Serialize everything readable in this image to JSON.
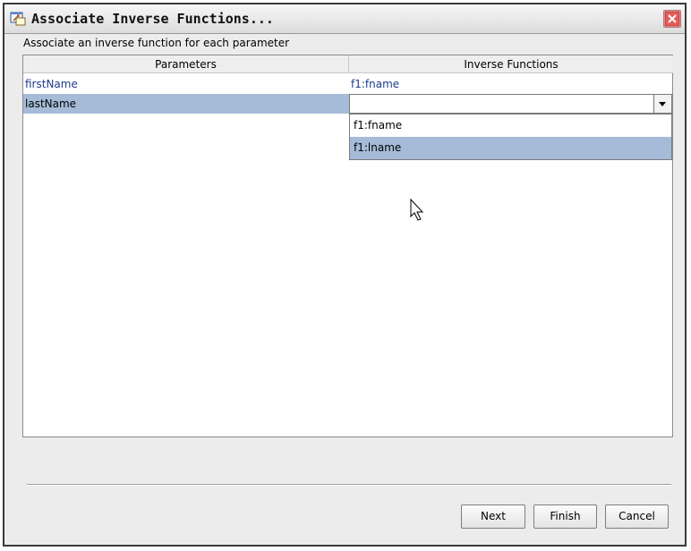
{
  "window": {
    "title": "Associate Inverse Functions...",
    "title_icon": "function-mapping-icon",
    "close_icon": "close-icon"
  },
  "prompt": "Associate an inverse function for each parameter",
  "table": {
    "columns": [
      "Parameters",
      "Inverse Functions"
    ],
    "rows": [
      {
        "parameter": "firstName",
        "inverse": "f1:fname"
      },
      {
        "parameter": "lastName",
        "inverse": ""
      }
    ]
  },
  "dropdown": {
    "options": [
      "f1:fname",
      "f1:lname"
    ],
    "highlighted": "f1:lname",
    "chevron_icon": "chevron-down-icon"
  },
  "buttons": {
    "next": "Next",
    "finish": "Finish",
    "cancel": "Cancel"
  },
  "colors": {
    "selection": "#a5bbd8",
    "parameter_text": "#1d3b8c",
    "close_accent": "#d04040"
  }
}
